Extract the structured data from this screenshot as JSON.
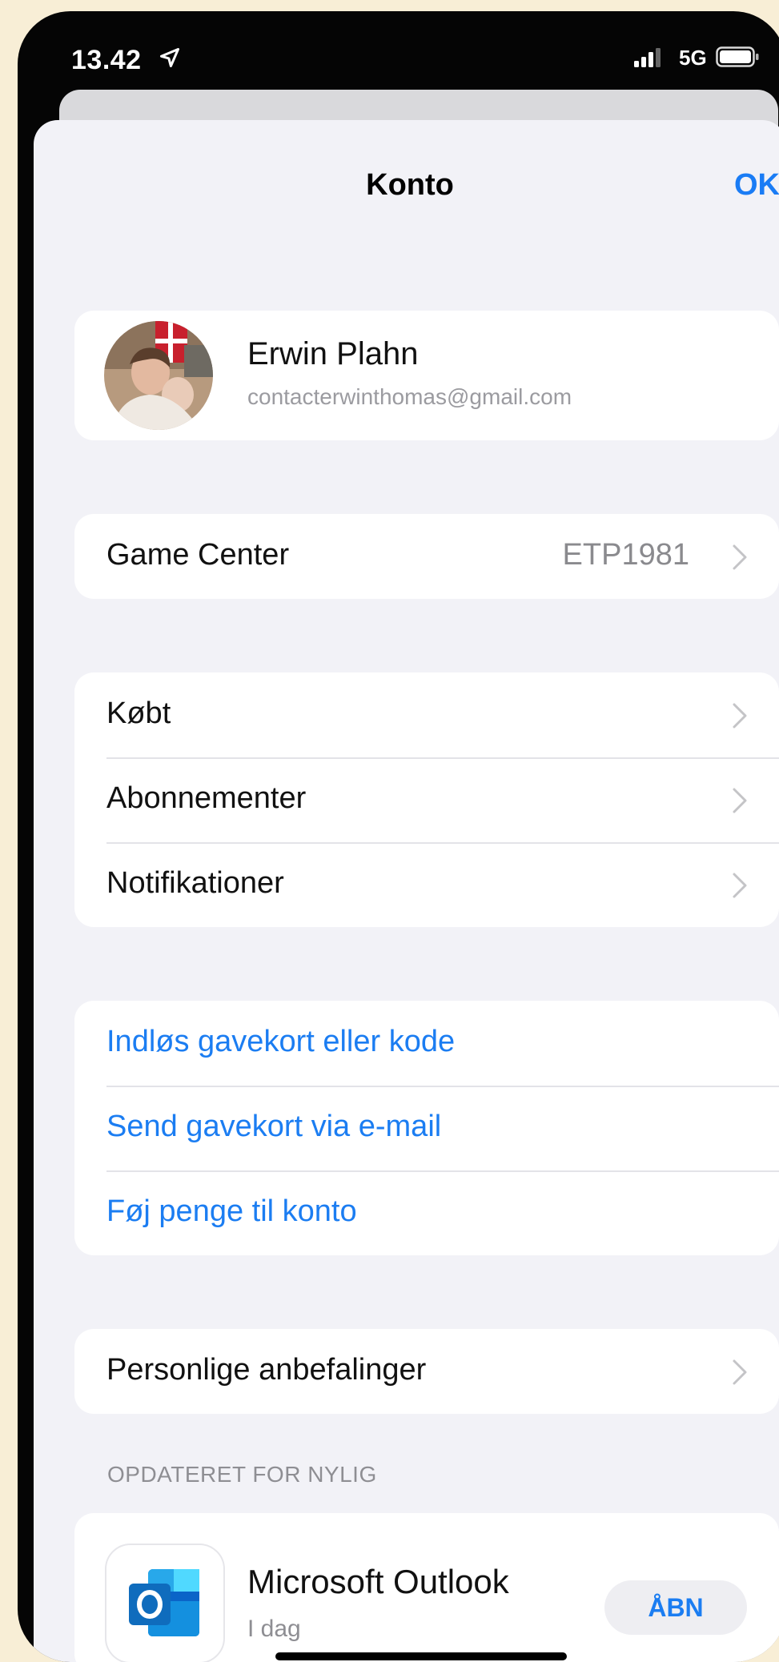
{
  "status_bar": {
    "time": "13.42",
    "network": "5G"
  },
  "nav": {
    "title": "Konto",
    "done_label": "OK"
  },
  "profile": {
    "name": "Erwin Plahn",
    "email": "contacterwinthomas@gmail.com"
  },
  "game_center": {
    "label": "Game Center",
    "value": "ETP1981"
  },
  "menu": [
    {
      "label": "Købt"
    },
    {
      "label": "Abonnementer"
    },
    {
      "label": "Notifikationer"
    }
  ],
  "gift_links": [
    {
      "label": "Indløs gavekort eller kode"
    },
    {
      "label": "Send gavekort via e-mail"
    },
    {
      "label": "Føj penge til konto"
    }
  ],
  "recommendations": {
    "label": "Personlige anbefalinger"
  },
  "recent_updates": {
    "header": "OPDATERET FOR NYLIG",
    "apps": [
      {
        "name": "Microsoft Outlook",
        "date": "I dag",
        "button": "ÅBN",
        "icon": "outlook-icon"
      }
    ]
  },
  "colors": {
    "accent": "#1b7df2",
    "background": "#f2f2f7",
    "frame": "#f8eed6"
  }
}
